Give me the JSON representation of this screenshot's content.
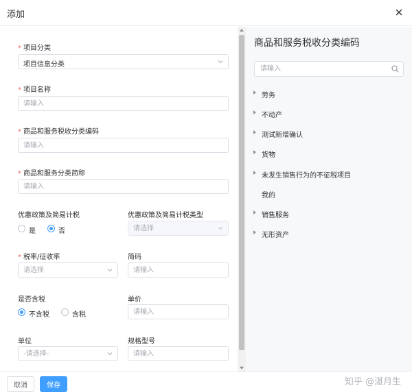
{
  "dialog": {
    "title": "添加",
    "close_icon": "close-icon"
  },
  "form": {
    "project_category": {
      "label": "项目分类",
      "value": "项目信息分类"
    },
    "project_name": {
      "label": "项目名称",
      "placeholder": "请输入"
    },
    "tax_code": {
      "label": "商品和服务税收分类编码",
      "placeholder": "请输入"
    },
    "category_short": {
      "label": "商品和服务分类简称",
      "placeholder": "请输入"
    },
    "preferential_policy": {
      "label": "优惠政策及简易计税",
      "options": [
        "是",
        "否"
      ],
      "selected": "否"
    },
    "preferential_type": {
      "label": "优惠政策及简易计税类型",
      "placeholder": "请选择"
    },
    "tax_rate": {
      "label": "税率/征收率",
      "placeholder": "请选择"
    },
    "short_code": {
      "label": "简码",
      "placeholder": "请输入"
    },
    "tax_included": {
      "label": "是否含税",
      "options": [
        "不含税",
        "含税"
      ],
      "selected": "不含税"
    },
    "unit_price": {
      "label": "单价",
      "placeholder": "请输入"
    },
    "unit": {
      "label": "单位",
      "placeholder": "-请选择-"
    },
    "spec_model": {
      "label": "规格型号",
      "placeholder": "请输入"
    }
  },
  "panel": {
    "title": "商品和服务税收分类编码",
    "search_placeholder": "请输入",
    "tree": [
      {
        "label": "劳务",
        "expandable": true
      },
      {
        "label": "不动产",
        "expandable": true
      },
      {
        "label": "测试新增确认",
        "expandable": true
      },
      {
        "label": "货物",
        "expandable": true
      },
      {
        "label": "未发生销售行为的不征税项目",
        "expandable": true
      },
      {
        "label": "我的",
        "expandable": false
      },
      {
        "label": "销售服务",
        "expandable": true
      },
      {
        "label": "无形资产",
        "expandable": true
      }
    ]
  },
  "footer": {
    "cancel_label": "取消",
    "save_label": "保存"
  },
  "watermark": "知乎 @湛月生",
  "colors": {
    "primary": "#409eff",
    "required": "#f56c6c",
    "panel_bg": "#f7f8fa"
  }
}
